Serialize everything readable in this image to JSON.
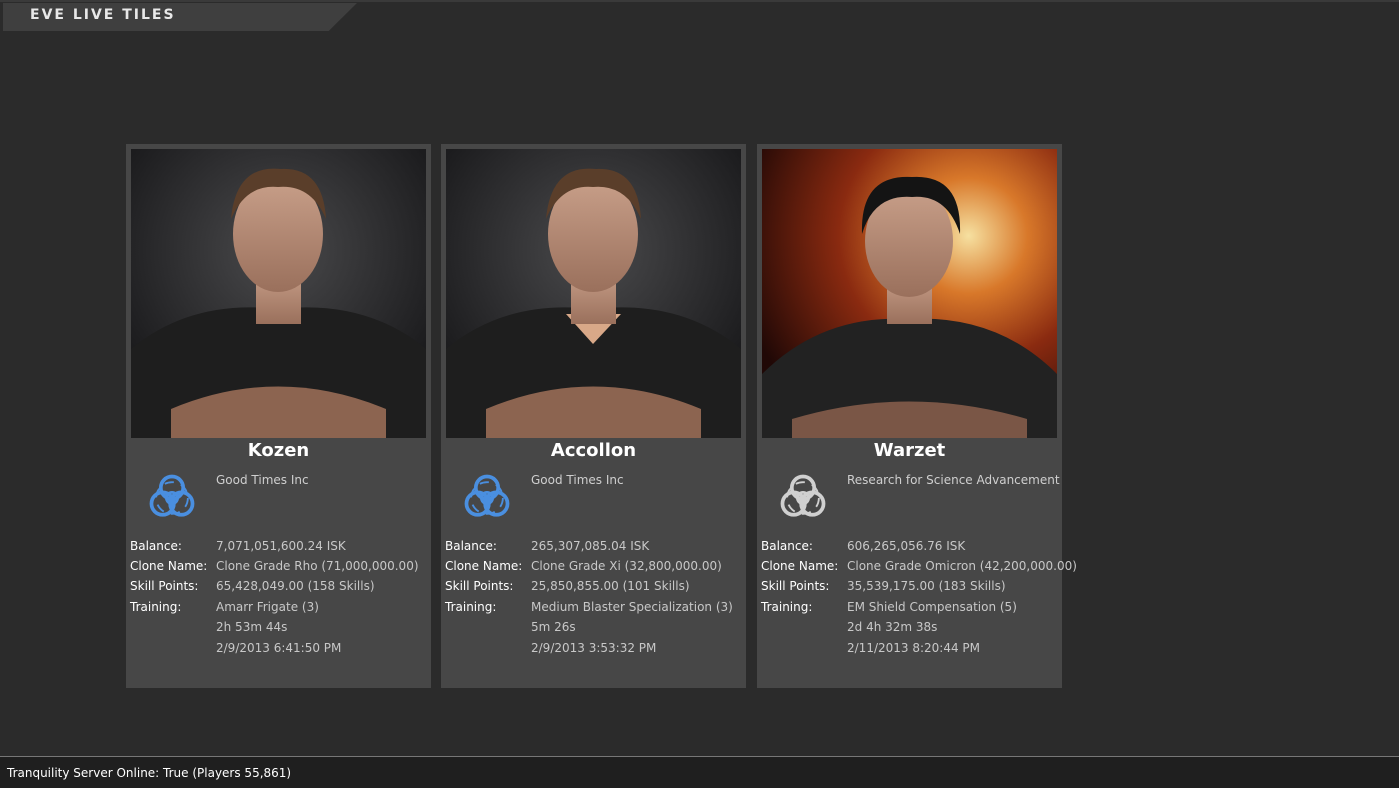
{
  "app": {
    "title": "EVE LIVE TILES"
  },
  "labels": {
    "balance": "Balance:",
    "clone_name": "Clone Name:",
    "skill_points": "Skill Points:",
    "training": "Training:"
  },
  "characters": [
    {
      "name": "Kozen",
      "corporation": "Good Times Inc",
      "corp_logo_icon": "biohazard-blue-icon",
      "balance": "7,071,051,600.24 ISK",
      "clone_name": "Clone Grade Rho  (71,000,000.00)",
      "skill_points": "65,428,049.00  (158 Skills)",
      "training_skill": "Amarr Frigate (3)",
      "training_remaining": "2h 53m 44s",
      "training_finish": "2/9/2013 6:41:50 PM"
    },
    {
      "name": "Accollon",
      "corporation": "Good Times Inc",
      "corp_logo_icon": "biohazard-blue-icon",
      "balance": "265,307,085.04 ISK",
      "clone_name": "Clone Grade Xi  (32,800,000.00)",
      "skill_points": "25,850,855.00  (101 Skills)",
      "training_skill": "Medium Blaster Specialization (3)",
      "training_remaining": "5m 26s",
      "training_finish": "2/9/2013 3:53:32 PM"
    },
    {
      "name": "Warzet",
      "corporation": "Research for Science Advancement",
      "corp_logo_icon": "biohazard-silver-icon",
      "balance": "606,265,056.76 ISK",
      "clone_name": "Clone Grade Omicron  (42,200,000.00)",
      "skill_points": "35,539,175.00  (183 Skills)",
      "training_skill": "EM Shield Compensation (5)",
      "training_remaining": "2d 4h 32m 38s",
      "training_finish": "2/11/2013 8:20:44 PM"
    }
  ],
  "status": {
    "text": "Tranquility Server Online: True  (Players  55,861)"
  },
  "colors": {
    "background": "#2b2b2b",
    "card": "#474747",
    "logo_blue": "#4a8fe0",
    "logo_silver": "#d0d0d0"
  }
}
